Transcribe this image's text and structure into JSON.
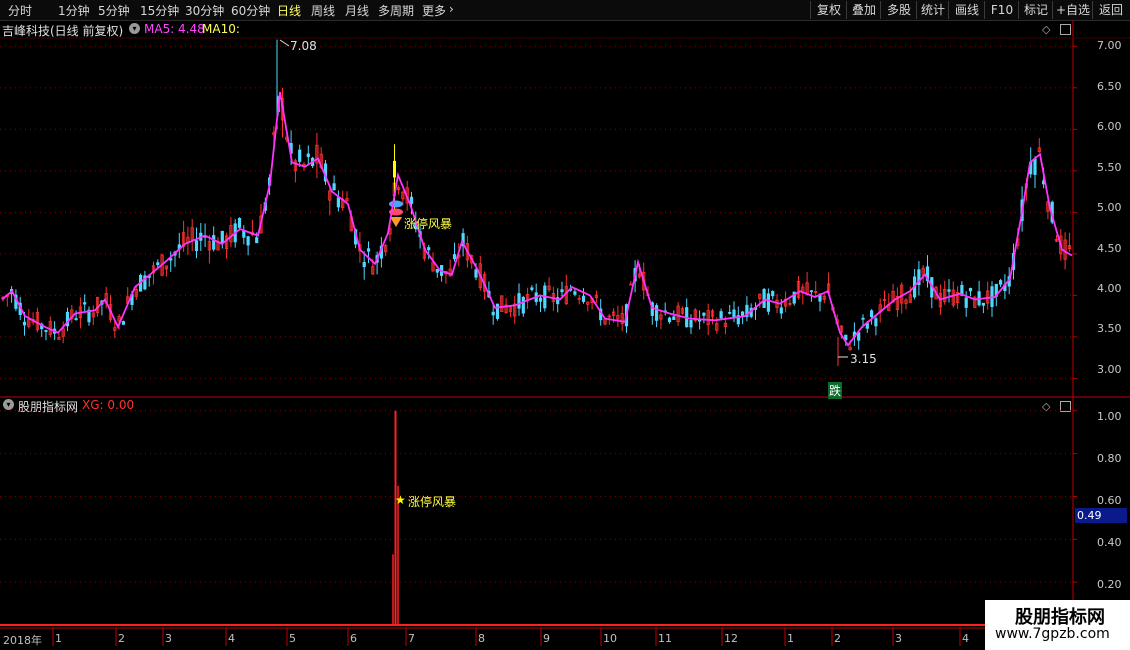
{
  "toolbar": {
    "periods": [
      "分时",
      "1分钟",
      "5分钟",
      "15分钟",
      "30分钟",
      "60分钟",
      "日线",
      "周线",
      "月线",
      "多周期",
      "更多"
    ],
    "more_chevron": "›",
    "right_buttons": [
      "复权",
      "叠加",
      "多股",
      "统计",
      "画线",
      "F10",
      "标记",
      "+自选",
      "返回"
    ]
  },
  "main": {
    "stock_title": "吉峰科技(日线 前复权)",
    "ma5": "MA5: 4.48",
    "ma10": "MA10:",
    "high_label": "7.08",
    "low_label": "3.15",
    "signal_label": "涨停风暴",
    "die_label": "跌",
    "y_ticks": [
      "7.00",
      "6.50",
      "6.00",
      "5.50",
      "5.00",
      "4.50",
      "4.00",
      "3.50",
      "3.00"
    ],
    "colors": {
      "ma": "#ff33ff",
      "up": "#ff3030",
      "down": "#4fd8ff",
      "grid": "#8b0000",
      "signal": "#ffff00"
    }
  },
  "sub": {
    "title": "股朋指标网",
    "xg": "XG: 0.00",
    "signal_label": "涨停风暴",
    "y_ticks": [
      "1.00",
      "0.80",
      "0.60",
      "0.40",
      "0.20"
    ],
    "current": "0.49"
  },
  "x_axis": {
    "year": "2018年",
    "months": [
      "1",
      "2",
      "3",
      "4",
      "5",
      "6",
      "7",
      "8",
      "9",
      "10",
      "11",
      "12",
      "1",
      "2",
      "3",
      "4"
    ]
  },
  "watermark": {
    "name": "股朋指标网",
    "url": "www.7gpzb.com"
  },
  "chart_data": {
    "type": "line",
    "title": "吉峰科技(日线 前复权)",
    "xlabel": "",
    "ylabel": "",
    "ylim": [
      2.8,
      7.1
    ],
    "x": [
      "2018-01",
      "2018-02",
      "2018-03",
      "2018-04",
      "2018-05",
      "2018-06",
      "2018-07",
      "2018-08",
      "2018-09",
      "2018-10",
      "2018-11",
      "2018-12",
      "2019-01",
      "2019-02",
      "2019-03",
      "2019-04"
    ],
    "series": [
      {
        "name": "MA5",
        "values": [
          3.85,
          3.62,
          4.25,
          4.72,
          6.2,
          5.05,
          5.3,
          3.9,
          3.95,
          4.15,
          3.72,
          3.8,
          3.98,
          3.4,
          4.18,
          4.48
        ]
      }
    ],
    "annotations": [
      {
        "label": "7.08",
        "value": 7.08
      },
      {
        "label": "3.15",
        "value": 3.15
      }
    ],
    "indicator": {
      "name": "XG",
      "ylim": [
        0,
        1.05
      ],
      "spike_value": 1.0,
      "current": 0.49
    }
  }
}
